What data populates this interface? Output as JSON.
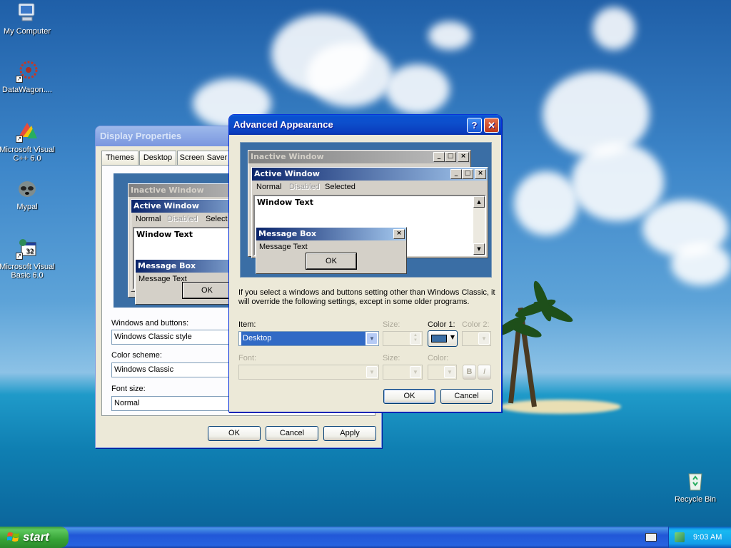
{
  "desktop": {
    "icons": [
      {
        "label": "My Computer",
        "icon": "my-computer-icon"
      },
      {
        "label": "DataWagon....",
        "icon": "datawagon-icon"
      },
      {
        "label": "Microsoft Visual C++ 6.0",
        "icon": "visual-cpp-icon"
      },
      {
        "label": "Mypal",
        "icon": "mypal-icon"
      },
      {
        "label": "Microsoft Visual Basic 6.0",
        "icon": "visual-basic-icon"
      }
    ],
    "recycle_bin": {
      "label": "Recycle Bin",
      "icon": "recycle-bin-icon"
    }
  },
  "display_properties": {
    "title": "Display Properties",
    "tabs": [
      "Themes",
      "Desktop",
      "Screen Saver"
    ],
    "preview": {
      "inactive_title": "Inactive Window",
      "active_title": "Active Window",
      "menu_normal": "Normal",
      "menu_disabled": "Disabled",
      "menu_selected": "Select",
      "window_text": "Window Text",
      "msgbox_title": "Message Box",
      "msgbox_text": "Message Text",
      "ok": "OK"
    },
    "windows_buttons_label": "Windows and buttons:",
    "windows_buttons_value": "Windows Classic style",
    "color_scheme_label": "Color scheme:",
    "color_scheme_value": "Windows Classic",
    "font_size_label": "Font size:",
    "font_size_value": "Normal",
    "ok": "OK",
    "cancel": "Cancel",
    "apply": "Apply"
  },
  "advanced_appearance": {
    "title": "Advanced Appearance",
    "help_glyph": "?",
    "close_glyph": "✕",
    "preview": {
      "inactive_title": "Inactive Window",
      "active_title": "Active Window",
      "menu_normal": "Normal",
      "menu_disabled": "Disabled",
      "menu_selected": "Selected",
      "window_text": "Window Text",
      "msgbox_title": "Message Box",
      "msgbox_text": "Message Text",
      "ok": "OK"
    },
    "note": "If you select a windows and buttons setting other than Windows Classic, it will override the following settings, except in some older programs.",
    "item_label": "Item:",
    "item_value": "Desktop",
    "size_label": "Size:",
    "color1_label": "Color 1:",
    "color1_value": "#3a6ea5",
    "color2_label": "Color 2:",
    "font_label": "Font:",
    "font_size_label": "Size:",
    "font_color_label": "Color:",
    "bold_glyph": "B",
    "italic_glyph": "I",
    "ok": "OK",
    "cancel": "Cancel"
  },
  "taskbar": {
    "start": "start",
    "clock": "9:03 AM"
  }
}
